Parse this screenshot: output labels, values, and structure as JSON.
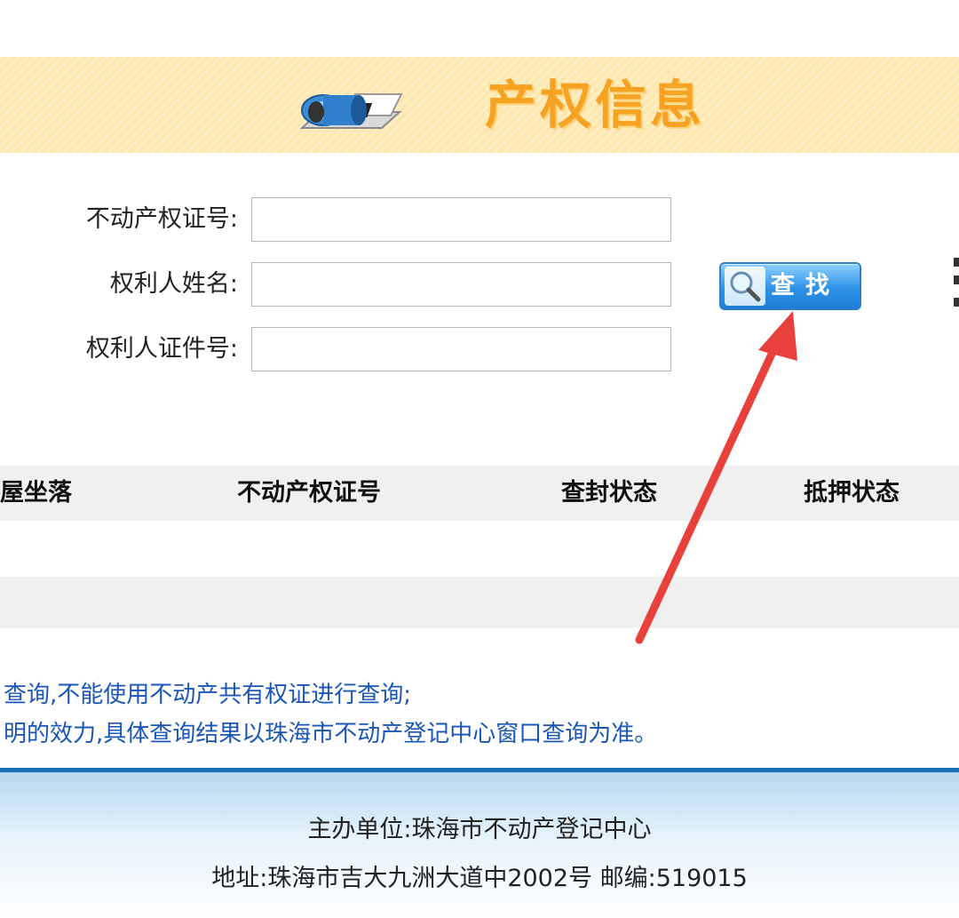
{
  "banner": {
    "title": "产权信息"
  },
  "form": {
    "cert_label": "不动产权证号:",
    "owner_label": "权利人姓名:",
    "id_label": "权利人证件号:",
    "cert_value": "",
    "owner_value": "",
    "id_value": ""
  },
  "search_button": {
    "label": "查找"
  },
  "table": {
    "headers": [
      "屋坐落",
      "不动产权证号",
      "查封状态",
      "抵押状态"
    ]
  },
  "notice": {
    "line1": "查询,不能使用不动产共有权证进行查询;",
    "line2": "明的效力,具体查询结果以珠海市不动产登记中心窗口查询为准。"
  },
  "footer": {
    "organizer": "主办单位:珠海市不动产登记中心",
    "address": "地址:珠海市吉大九洲大道中2002号 邮编:519015"
  },
  "colors": {
    "banner_title": "#f6a323",
    "notice_text": "#1a56b8",
    "arrow": "#e8413c",
    "button": "#2e92e6"
  }
}
